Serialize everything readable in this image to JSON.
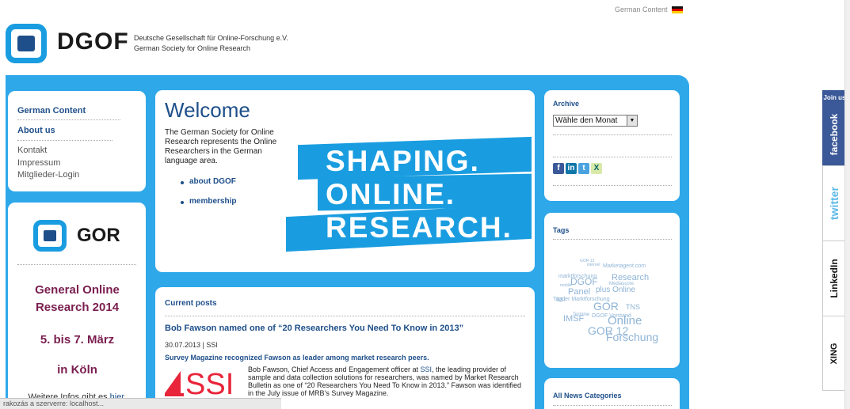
{
  "header": {
    "lang_link": "German Content",
    "logo_text": "DGOF",
    "subtitle_de": "Deutsche Gesellschaft für Online-Forschung e.V.",
    "subtitle_en": "German Society for Online Research"
  },
  "nav": {
    "german_content": "German Content",
    "about_us": "About us",
    "links": [
      "Kontakt",
      "Impressum",
      "Mitglieder-Login"
    ]
  },
  "gor": {
    "logo_text": "GOR",
    "line1": "General Online",
    "line2": "Research 2014",
    "line3": "5. bis 7. März",
    "line4": "in Köln",
    "more_prefix": "Weitere Infos gibt es ",
    "more_link": "hier."
  },
  "welcome": {
    "title": "Welcome",
    "description": "The German Society for Online Research represents the Online Researchers in the German language area.",
    "links": [
      "about DGOF",
      "membership"
    ],
    "banner": [
      "SHAPING.",
      "ONLINE.",
      "RESEARCH."
    ]
  },
  "posts": {
    "heading": "Current posts",
    "title": "Bob Fawson named one of “20 Researchers You Need To Know in 2013”",
    "date": "30.07.2013 | SSI",
    "subtitle": "Survey Magazine recognized Fawson as leader among market research peers.",
    "body_a": "Bob Fawson, Chief Access and Engagement officer at ",
    "body_ssi": "SSI",
    "body_b": ", the leading provider of sample and data collection solutions for researchers, was named by Market Research Bulletin as one of “20 Researchers You Need To Know in 2013.” Fawson was identified in the July issue of MRB’s Survey Magazine.",
    "logo": "SSI"
  },
  "archive": {
    "heading": "Archive",
    "select_value": "Wähle den Monat"
  },
  "social_icons": [
    "facebook-icon",
    "linkedin-icon",
    "twitter-icon",
    "xing-icon"
  ],
  "tags": {
    "heading": "Tags",
    "cloud": [
      {
        "t": "GOR 13",
        "s": 5
      },
      {
        "t": "internet",
        "s": 5
      },
      {
        "t": "Marketagent.com",
        "s": 7
      },
      {
        "t": "marktforschung",
        "s": 7
      },
      {
        "t": "DGOF",
        "s": 12
      },
      {
        "t": "Research",
        "s": 11
      },
      {
        "t": "mobile",
        "s": 5
      },
      {
        "t": "Mediascore",
        "s": 6
      },
      {
        "t": "Panel",
        "s": 11
      },
      {
        "t": "plus Online",
        "s": 10
      },
      {
        "t": "Tagder Marktforschung",
        "s": 7
      },
      {
        "t": "SSI",
        "s": 7
      },
      {
        "t": "GOR",
        "s": 14
      },
      {
        "t": "TNS",
        "s": 9
      },
      {
        "t": "Termine",
        "s": 6
      },
      {
        "t": "DGOF Vorstand",
        "s": 7
      },
      {
        "t": "IMSF",
        "s": 11
      },
      {
        "t": "Online",
        "s": 15
      },
      {
        "t": "GOR 12",
        "s": 14
      },
      {
        "t": "Forschung",
        "s": 14
      }
    ]
  },
  "categories": {
    "heading": "All News Categories"
  },
  "sidebar_social": {
    "join_us": "Join us",
    "facebook": "facebook",
    "twitter": "twitter",
    "linkedin": "LinkedIn",
    "xing": "XING"
  },
  "status_bar": "rakozás a szerverre: localhost..."
}
